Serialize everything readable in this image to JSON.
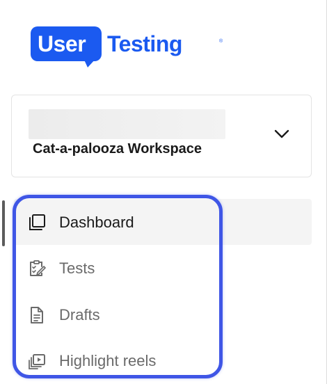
{
  "logo": {
    "part1": "User",
    "part2": "Testing",
    "registered": "®",
    "brand_color": "#1b5af0"
  },
  "workspace": {
    "name": "Cat-a-palooza Workspace",
    "dropdown_icon": "chevron-down-icon"
  },
  "nav": {
    "highlight_color": "#3f56e6",
    "items": [
      {
        "label": "Dashboard",
        "icon": "dashboard-icon",
        "active": true
      },
      {
        "label": "Tests",
        "icon": "tests-clipboard-icon",
        "active": false
      },
      {
        "label": "Drafts",
        "icon": "document-icon",
        "active": false
      },
      {
        "label": "Highlight reels",
        "icon": "highlight-reels-icon",
        "active": false
      }
    ]
  }
}
